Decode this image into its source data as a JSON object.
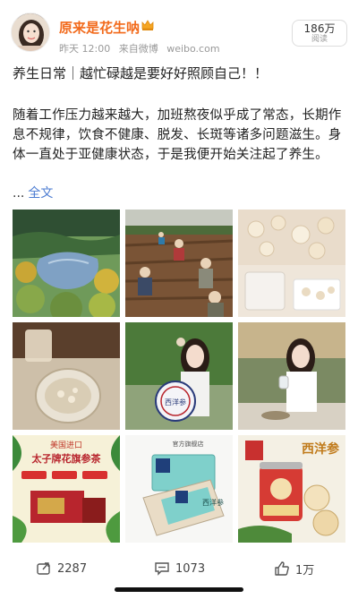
{
  "user": {
    "name": "原来是花生呐",
    "time": "昨天 12:00",
    "source": "来自微博",
    "site": "weibo.com"
  },
  "views": {
    "count": "186万",
    "label": "阅读"
  },
  "post": {
    "title": "养生日常｜越忙碌越是要好好照顾自己！！",
    "body": "随着工作压力越来越大，加班熬夜似乎成了常态，长期作息不规律，饮食不健康、脱发、长斑等诸多问题滋生。身体一直处于亚健康状态，于是我便开始关注起了养生。",
    "ellipsis": "...",
    "more_label": "全文"
  },
  "images": {
    "img5_text": "西洋参",
    "img7_title": "美国进口",
    "img7_sub": "太子牌花旗参茶",
    "img8_brand": "官方旗舰店",
    "img8_box": "西洋参",
    "img9_title": "西洋参"
  },
  "actions": {
    "repost": "2287",
    "comment": "1073",
    "like": "1万"
  },
  "colors": {
    "accent": "#f26a1b",
    "link": "#4b7bd1"
  },
  "icons": [
    "crown-icon",
    "repost-icon",
    "comment-icon",
    "like-icon"
  ]
}
